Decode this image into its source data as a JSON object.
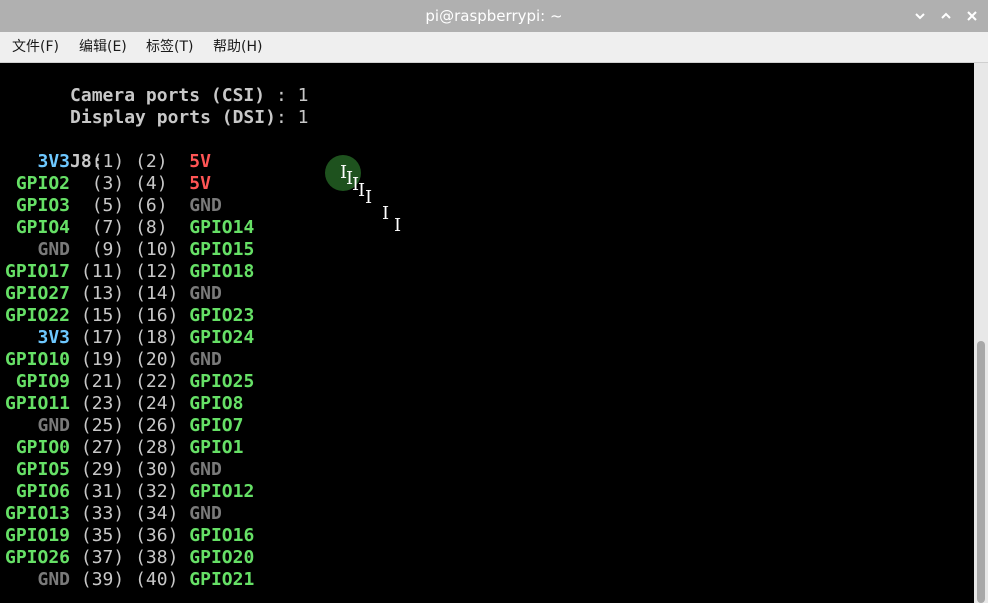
{
  "window": {
    "title": "pi@raspberrypi: ~"
  },
  "menu": {
    "file": "文件(F)",
    "edit": "编辑(E)",
    "tabs": "标签(T)",
    "help": "帮助(H)"
  },
  "terminal": {
    "camera_label": "Camera ports (CSI)",
    "camera_value": " : 1",
    "display_label": "Display ports (DSI)",
    "display_value": ": 1",
    "header": "J8:",
    "pins": [
      {
        "left": "   3V3",
        "left_color": "blue",
        "p1": "(1)",
        "p2": "(2)",
        "right": "5V",
        "right_color": "red"
      },
      {
        "left": " GPIO2",
        "left_color": "green",
        "p1": "(3)",
        "p2": "(4)",
        "right": "5V",
        "right_color": "red"
      },
      {
        "left": " GPIO3",
        "left_color": "green",
        "p1": "(5)",
        "p2": "(6)",
        "right": "GND",
        "right_color": "gray"
      },
      {
        "left": " GPIO4",
        "left_color": "green",
        "p1": "(7)",
        "p2": "(8)",
        "right": "GPIO14",
        "right_color": "green"
      },
      {
        "left": "   GND",
        "left_color": "gray",
        "p1": "(9)",
        "p2": "(10)",
        "right": "GPIO15",
        "right_color": "green"
      },
      {
        "left": "GPIO17",
        "left_color": "green",
        "p1": "(11)",
        "p2": "(12)",
        "right": "GPIO18",
        "right_color": "green"
      },
      {
        "left": "GPIO27",
        "left_color": "green",
        "p1": "(13)",
        "p2": "(14)",
        "right": "GND",
        "right_color": "gray"
      },
      {
        "left": "GPIO22",
        "left_color": "green",
        "p1": "(15)",
        "p2": "(16)",
        "right": "GPIO23",
        "right_color": "green"
      },
      {
        "left": "   3V3",
        "left_color": "blue",
        "p1": "(17)",
        "p2": "(18)",
        "right": "GPIO24",
        "right_color": "green"
      },
      {
        "left": "GPIO10",
        "left_color": "green",
        "p1": "(19)",
        "p2": "(20)",
        "right": "GND",
        "right_color": "gray"
      },
      {
        "left": " GPIO9",
        "left_color": "green",
        "p1": "(21)",
        "p2": "(22)",
        "right": "GPIO25",
        "right_color": "green"
      },
      {
        "left": "GPIO11",
        "left_color": "green",
        "p1": "(23)",
        "p2": "(24)",
        "right": "GPIO8",
        "right_color": "green"
      },
      {
        "left": "   GND",
        "left_color": "gray",
        "p1": "(25)",
        "p2": "(26)",
        "right": "GPIO7",
        "right_color": "green"
      },
      {
        "left": " GPIO0",
        "left_color": "green",
        "p1": "(27)",
        "p2": "(28)",
        "right": "GPIO1",
        "right_color": "green"
      },
      {
        "left": " GPIO5",
        "left_color": "green",
        "p1": "(29)",
        "p2": "(30)",
        "right": "GND",
        "right_color": "gray"
      },
      {
        "left": " GPIO6",
        "left_color": "green",
        "p1": "(31)",
        "p2": "(32)",
        "right": "GPIO12",
        "right_color": "green"
      },
      {
        "left": "GPIO13",
        "left_color": "green",
        "p1": "(33)",
        "p2": "(34)",
        "right": "GND",
        "right_color": "gray"
      },
      {
        "left": "GPIO19",
        "left_color": "green",
        "p1": "(35)",
        "p2": "(36)",
        "right": "GPIO16",
        "right_color": "green"
      },
      {
        "left": "GPIO26",
        "left_color": "green",
        "p1": "(37)",
        "p2": "(38)",
        "right": "GPIO20",
        "right_color": "green"
      },
      {
        "left": "   GND",
        "left_color": "gray",
        "p1": "(39)",
        "p2": "(40)",
        "right": "GPIO21",
        "right_color": "green"
      }
    ]
  },
  "colors": {
    "titlebar": "#b0b0b0",
    "menubar": "#efefef",
    "terminal_bg": "#000000",
    "text": "#c8c8c8",
    "power_3v3": "#6ec8ff",
    "power_5v": "#ff5555",
    "gpio": "#66e066",
    "ground": "#7a7a7a"
  },
  "icons": {
    "minimize": "chevron-down-icon",
    "maximize": "chevron-up-icon",
    "close": "close-icon",
    "pointer": "text-cursor-icon"
  }
}
